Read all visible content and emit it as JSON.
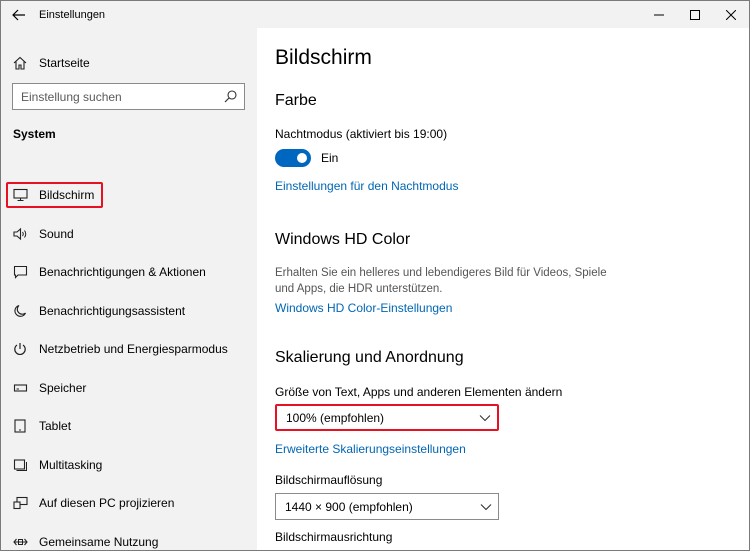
{
  "window": {
    "title": "Einstellungen"
  },
  "sidebar": {
    "home_label": "Startseite",
    "search_placeholder": "Einstellung suchen",
    "section_title": "System",
    "items": [
      {
        "label": "Bildschirm",
        "icon": "monitor-icon",
        "selected": true
      },
      {
        "label": "Sound",
        "icon": "speaker-icon"
      },
      {
        "label": "Benachrichtigungen & Aktionen",
        "icon": "notification-icon"
      },
      {
        "label": "Benachrichtigungsassistent",
        "icon": "moon-icon"
      },
      {
        "label": "Netzbetrieb und Energiesparmodus",
        "icon": "power-icon"
      },
      {
        "label": "Speicher",
        "icon": "storage-icon"
      },
      {
        "label": "Tablet",
        "icon": "tablet-icon"
      },
      {
        "label": "Multitasking",
        "icon": "multitasking-icon"
      },
      {
        "label": "Auf diesen PC projizieren",
        "icon": "project-icon"
      },
      {
        "label": "Gemeinsame Nutzung",
        "icon": "shared-icon"
      }
    ]
  },
  "main": {
    "title": "Bildschirm",
    "color_section": {
      "heading": "Farbe",
      "night_mode_label": "Nachtmodus (aktiviert bis 19:00)",
      "toggle_state": "Ein",
      "settings_link": "Einstellungen für den Nachtmodus"
    },
    "hdr_section": {
      "heading": "Windows HD Color",
      "description": "Erhalten Sie ein helleres und lebendigeres Bild für Videos, Spiele und Apps, die HDR unterstützen.",
      "link": "Windows HD Color-Einstellungen"
    },
    "scale_section": {
      "heading": "Skalierung und Anordnung",
      "size_label": "Größe von Text, Apps und anderen Elementen ändern",
      "size_value": "100% (empfohlen)",
      "advanced_link": "Erweiterte Skalierungseinstellungen",
      "resolution_label": "Bildschirmauflösung",
      "resolution_value": "1440 × 900 (empfohlen)",
      "orientation_label": "Bildschirmausrichtung"
    }
  },
  "colors": {
    "accent": "#0067c0",
    "link": "#0066b4",
    "highlight": "#e81123",
    "sidebar_bg": "#f2f2f2"
  }
}
